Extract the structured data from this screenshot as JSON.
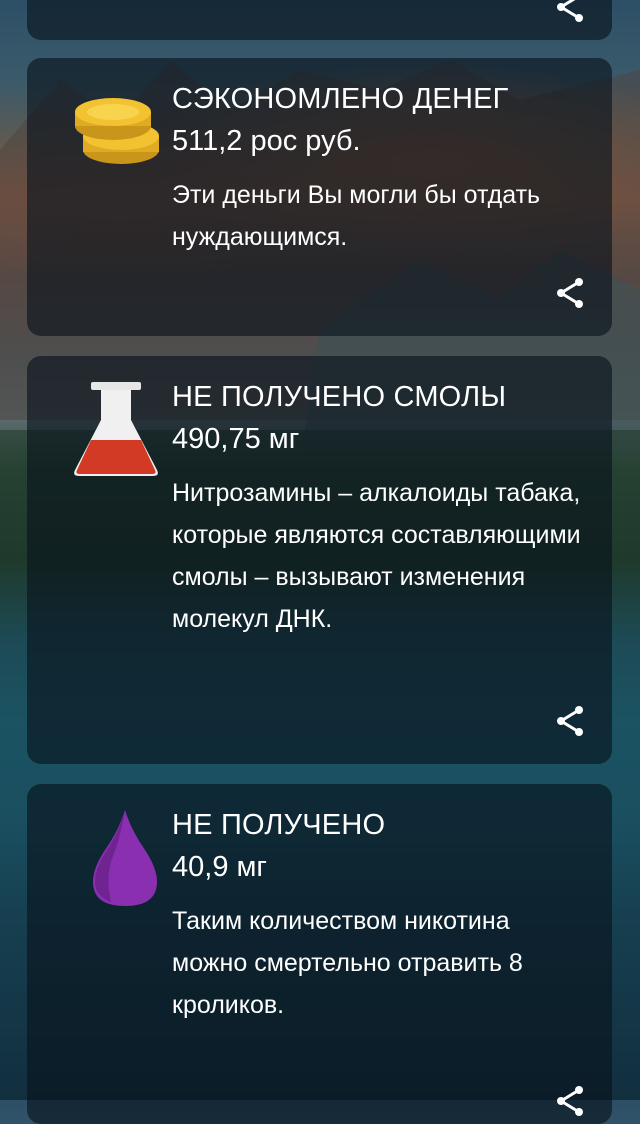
{
  "background": {
    "accent_orange": "#c4663a",
    "lake": "#1b5362"
  },
  "cards": [
    {
      "icon": "coins-icon",
      "title": "СЭКОНОМЛЕНО ДЕНЕГ",
      "value": "511,2 рос руб.",
      "description": "Эти деньги Вы могли бы отдать нуждающимся.",
      "share_icon": "share-icon"
    },
    {
      "icon": "flask-icon",
      "title": "НЕ ПОЛУЧЕНО СМОЛЫ",
      "value": "490,75 мг",
      "description": "Нитрозамины – алкалоиды табака, которые являются составляющими смолы – вызывают изменения молекул ДНК.",
      "share_icon": "share-icon"
    },
    {
      "icon": "drop-icon",
      "title": "НЕ ПОЛУЧЕНО",
      "value": "40,9 мг",
      "description": "Таким количеством никотина можно смертельно отравить 8 кроликов.",
      "share_icon": "share-icon"
    }
  ],
  "colors": {
    "coin": "#f2c230",
    "flask_liquid": "#d23a25",
    "drop": "#8a2fb0",
    "card_bg": "rgba(8,18,28,0.62)"
  }
}
